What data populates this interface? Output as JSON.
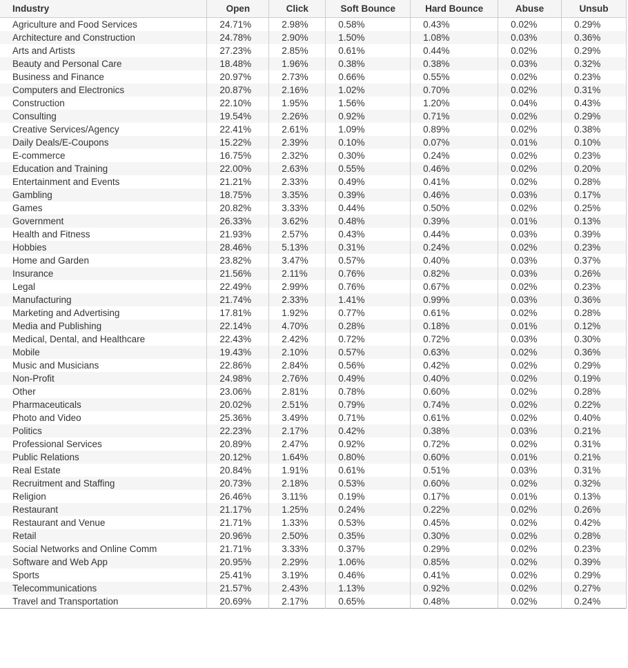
{
  "table": {
    "headers": {
      "industry": "Industry",
      "open": "Open",
      "click": "Click",
      "soft_bounce": "Soft Bounce",
      "hard_bounce": "Hard Bounce",
      "abuse": "Abuse",
      "unsub": "Unsub"
    },
    "rows": [
      {
        "industry": "Agriculture and Food Services",
        "open": "24.71%",
        "click": "2.98%",
        "soft": "0.58%",
        "hard": "0.43%",
        "abuse": "0.02%",
        "unsub": "0.29%"
      },
      {
        "industry": "Architecture and Construction",
        "open": "24.78%",
        "click": "2.90%",
        "soft": "1.50%",
        "hard": "1.08%",
        "abuse": "0.03%",
        "unsub": "0.36%"
      },
      {
        "industry": "Arts and Artists",
        "open": "27.23%",
        "click": "2.85%",
        "soft": "0.61%",
        "hard": "0.44%",
        "abuse": "0.02%",
        "unsub": "0.29%"
      },
      {
        "industry": "Beauty and Personal Care",
        "open": "18.48%",
        "click": "1.96%",
        "soft": "0.38%",
        "hard": "0.38%",
        "abuse": "0.03%",
        "unsub": "0.32%"
      },
      {
        "industry": "Business and Finance",
        "open": "20.97%",
        "click": "2.73%",
        "soft": "0.66%",
        "hard": "0.55%",
        "abuse": "0.02%",
        "unsub": "0.23%"
      },
      {
        "industry": "Computers and Electronics",
        "open": "20.87%",
        "click": "2.16%",
        "soft": "1.02%",
        "hard": "0.70%",
        "abuse": "0.02%",
        "unsub": "0.31%"
      },
      {
        "industry": "Construction",
        "open": "22.10%",
        "click": "1.95%",
        "soft": "1.56%",
        "hard": "1.20%",
        "abuse": "0.04%",
        "unsub": "0.43%"
      },
      {
        "industry": "Consulting",
        "open": "19.54%",
        "click": "2.26%",
        "soft": "0.92%",
        "hard": "0.71%",
        "abuse": "0.02%",
        "unsub": "0.29%"
      },
      {
        "industry": "Creative Services/Agency",
        "open": "22.41%",
        "click": "2.61%",
        "soft": "1.09%",
        "hard": "0.89%",
        "abuse": "0.02%",
        "unsub": "0.38%"
      },
      {
        "industry": "Daily Deals/E-Coupons",
        "open": "15.22%",
        "click": "2.39%",
        "soft": "0.10%",
        "hard": "0.07%",
        "abuse": "0.01%",
        "unsub": "0.10%"
      },
      {
        "industry": "E-commerce",
        "open": "16.75%",
        "click": "2.32%",
        "soft": "0.30%",
        "hard": "0.24%",
        "abuse": "0.02%",
        "unsub": "0.23%"
      },
      {
        "industry": "Education and Training",
        "open": "22.00%",
        "click": "2.63%",
        "soft": "0.55%",
        "hard": "0.46%",
        "abuse": "0.02%",
        "unsub": "0.20%"
      },
      {
        "industry": "Entertainment and Events",
        "open": "21.21%",
        "click": "2.33%",
        "soft": "0.49%",
        "hard": "0.41%",
        "abuse": "0.02%",
        "unsub": "0.28%"
      },
      {
        "industry": "Gambling",
        "open": "18.75%",
        "click": "3.35%",
        "soft": "0.39%",
        "hard": "0.46%",
        "abuse": "0.03%",
        "unsub": "0.17%"
      },
      {
        "industry": "Games",
        "open": "20.82%",
        "click": "3.33%",
        "soft": "0.44%",
        "hard": "0.50%",
        "abuse": "0.02%",
        "unsub": "0.25%"
      },
      {
        "industry": "Government",
        "open": "26.33%",
        "click": "3.62%",
        "soft": "0.48%",
        "hard": "0.39%",
        "abuse": "0.01%",
        "unsub": "0.13%"
      },
      {
        "industry": "Health and Fitness",
        "open": "21.93%",
        "click": "2.57%",
        "soft": "0.43%",
        "hard": "0.44%",
        "abuse": "0.03%",
        "unsub": "0.39%"
      },
      {
        "industry": "Hobbies",
        "open": "28.46%",
        "click": "5.13%",
        "soft": "0.31%",
        "hard": "0.24%",
        "abuse": "0.02%",
        "unsub": "0.23%"
      },
      {
        "industry": "Home and Garden",
        "open": "23.82%",
        "click": "3.47%",
        "soft": "0.57%",
        "hard": "0.40%",
        "abuse": "0.03%",
        "unsub": "0.37%"
      },
      {
        "industry": "Insurance",
        "open": "21.56%",
        "click": "2.11%",
        "soft": "0.76%",
        "hard": "0.82%",
        "abuse": "0.03%",
        "unsub": "0.26%"
      },
      {
        "industry": "Legal",
        "open": "22.49%",
        "click": "2.99%",
        "soft": "0.76%",
        "hard": "0.67%",
        "abuse": "0.02%",
        "unsub": "0.23%"
      },
      {
        "industry": "Manufacturing",
        "open": "21.74%",
        "click": "2.33%",
        "soft": "1.41%",
        "hard": "0.99%",
        "abuse": "0.03%",
        "unsub": "0.36%"
      },
      {
        "industry": "Marketing and Advertising",
        "open": "17.81%",
        "click": "1.92%",
        "soft": "0.77%",
        "hard": "0.61%",
        "abuse": "0.02%",
        "unsub": "0.28%"
      },
      {
        "industry": "Media and Publishing",
        "open": "22.14%",
        "click": "4.70%",
        "soft": "0.28%",
        "hard": "0.18%",
        "abuse": "0.01%",
        "unsub": "0.12%"
      },
      {
        "industry": "Medical, Dental, and Healthcare",
        "open": "22.43%",
        "click": "2.42%",
        "soft": "0.72%",
        "hard": "0.72%",
        "abuse": "0.03%",
        "unsub": "0.30%"
      },
      {
        "industry": "Mobile",
        "open": "19.43%",
        "click": "2.10%",
        "soft": "0.57%",
        "hard": "0.63%",
        "abuse": "0.02%",
        "unsub": "0.36%"
      },
      {
        "industry": "Music and Musicians",
        "open": "22.86%",
        "click": "2.84%",
        "soft": "0.56%",
        "hard": "0.42%",
        "abuse": "0.02%",
        "unsub": "0.29%"
      },
      {
        "industry": "Non-Profit",
        "open": "24.98%",
        "click": "2.76%",
        "soft": "0.49%",
        "hard": "0.40%",
        "abuse": "0.02%",
        "unsub": "0.19%"
      },
      {
        "industry": "Other",
        "open": "23.06%",
        "click": "2.81%",
        "soft": "0.78%",
        "hard": "0.60%",
        "abuse": "0.02%",
        "unsub": "0.28%"
      },
      {
        "industry": "Pharmaceuticals",
        "open": "20.02%",
        "click": "2.51%",
        "soft": "0.79%",
        "hard": "0.74%",
        "abuse": "0.02%",
        "unsub": "0.22%"
      },
      {
        "industry": "Photo and Video",
        "open": "25.36%",
        "click": "3.49%",
        "soft": "0.71%",
        "hard": "0.61%",
        "abuse": "0.02%",
        "unsub": "0.40%"
      },
      {
        "industry": "Politics",
        "open": "22.23%",
        "click": "2.17%",
        "soft": "0.42%",
        "hard": "0.38%",
        "abuse": "0.03%",
        "unsub": "0.21%"
      },
      {
        "industry": "Professional Services",
        "open": "20.89%",
        "click": "2.47%",
        "soft": "0.92%",
        "hard": "0.72%",
        "abuse": "0.02%",
        "unsub": "0.31%"
      },
      {
        "industry": "Public Relations",
        "open": "20.12%",
        "click": "1.64%",
        "soft": "0.80%",
        "hard": "0.60%",
        "abuse": "0.01%",
        "unsub": "0.21%"
      },
      {
        "industry": "Real Estate",
        "open": "20.84%",
        "click": "1.91%",
        "soft": "0.61%",
        "hard": "0.51%",
        "abuse": "0.03%",
        "unsub": "0.31%"
      },
      {
        "industry": "Recruitment and Staffing",
        "open": "20.73%",
        "click": "2.18%",
        "soft": "0.53%",
        "hard": "0.60%",
        "abuse": "0.02%",
        "unsub": "0.32%"
      },
      {
        "industry": "Religion",
        "open": "26.46%",
        "click": "3.11%",
        "soft": "0.19%",
        "hard": "0.17%",
        "abuse": "0.01%",
        "unsub": "0.13%"
      },
      {
        "industry": "Restaurant",
        "open": "21.17%",
        "click": "1.25%",
        "soft": "0.24%",
        "hard": "0.22%",
        "abuse": "0.02%",
        "unsub": "0.26%"
      },
      {
        "industry": "Restaurant and Venue",
        "open": "21.71%",
        "click": "1.33%",
        "soft": "0.53%",
        "hard": "0.45%",
        "abuse": "0.02%",
        "unsub": "0.42%"
      },
      {
        "industry": "Retail",
        "open": "20.96%",
        "click": "2.50%",
        "soft": "0.35%",
        "hard": "0.30%",
        "abuse": "0.02%",
        "unsub": "0.28%"
      },
      {
        "industry": "Social Networks and Online Comm",
        "open": "21.71%",
        "click": "3.33%",
        "soft": "0.37%",
        "hard": "0.29%",
        "abuse": "0.02%",
        "unsub": "0.23%"
      },
      {
        "industry": "Software and Web App",
        "open": "20.95%",
        "click": "2.29%",
        "soft": "1.06%",
        "hard": "0.85%",
        "abuse": "0.02%",
        "unsub": "0.39%"
      },
      {
        "industry": "Sports",
        "open": "25.41%",
        "click": "3.19%",
        "soft": "0.46%",
        "hard": "0.41%",
        "abuse": "0.02%",
        "unsub": "0.29%"
      },
      {
        "industry": "Telecommunications",
        "open": "21.57%",
        "click": "2.43%",
        "soft": "1.13%",
        "hard": "0.92%",
        "abuse": "0.02%",
        "unsub": "0.27%"
      },
      {
        "industry": "Travel and Transportation",
        "open": "20.69%",
        "click": "2.17%",
        "soft": "0.65%",
        "hard": "0.48%",
        "abuse": "0.02%",
        "unsub": "0.24%"
      }
    ]
  }
}
